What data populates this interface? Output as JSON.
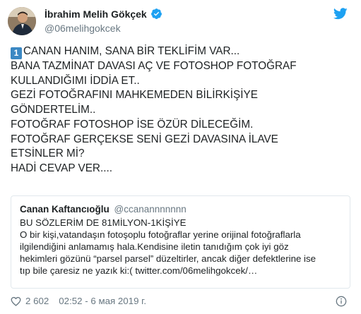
{
  "author": {
    "display_name": "İbrahim Melih Gökçek",
    "handle": "@06melihgokcek",
    "verified": true
  },
  "tweet": {
    "emoji": "1",
    "lines": [
      "CANAN HANIM, SANA BİR TEKLİFİM VAR...",
      "BANA TAZMİNAT DAVASI AÇ VE FOTOSHOP FOTOĞRAF",
      "KULLANDIĞIMI İDDİA ET..",
      "GEZİ FOTOĞRAFINI MAHKEMEDEN BİLİRKİŞİYE",
      "GÖNDERTELİM..",
      "FOTOĞRAF FOTOSHOP İSE ÖZÜR DİLECEĞİM.",
      "FOTOĞRAF GERÇEKSE SENİ GEZİ DAVASINA İLAVE",
      "ETSİNLER Mİ?",
      "HADİ CEVAP VER...."
    ]
  },
  "quoted_tweet": {
    "display_name": "Canan Kaftancıoğlu",
    "handle": "@ccanannnnnnn",
    "lines": [
      "BU SÖZLERİM DE 81MİLYON-1KİŞİYE",
      "O bir kişi,vatandaşın fotoşoplu fotoğraflar yerine orijinal fotoğraflarla",
      "ilgilendiğini anlamamış hala.Kendisine iletin tanıdığım çok iyi göz",
      "hekimleri gözünü “parsel parsel” düzeltirler, ancak diğer defektlerine ise",
      "tıp bile çaresiz ne yazık ki:( twitter.com/06melihgokcek/…"
    ]
  },
  "footer": {
    "likes": "2 602",
    "timestamp": "02:52 - 6 мая 2019 г."
  },
  "colors": {
    "twitter_blue": "#1da1f2",
    "secondary_text": "#697882",
    "border": "#e1e8ed"
  },
  "icons": [
    "verified-badge-icon",
    "twitter-bird-icon",
    "heart-icon",
    "info-icon",
    "keycap-one-icon"
  ]
}
